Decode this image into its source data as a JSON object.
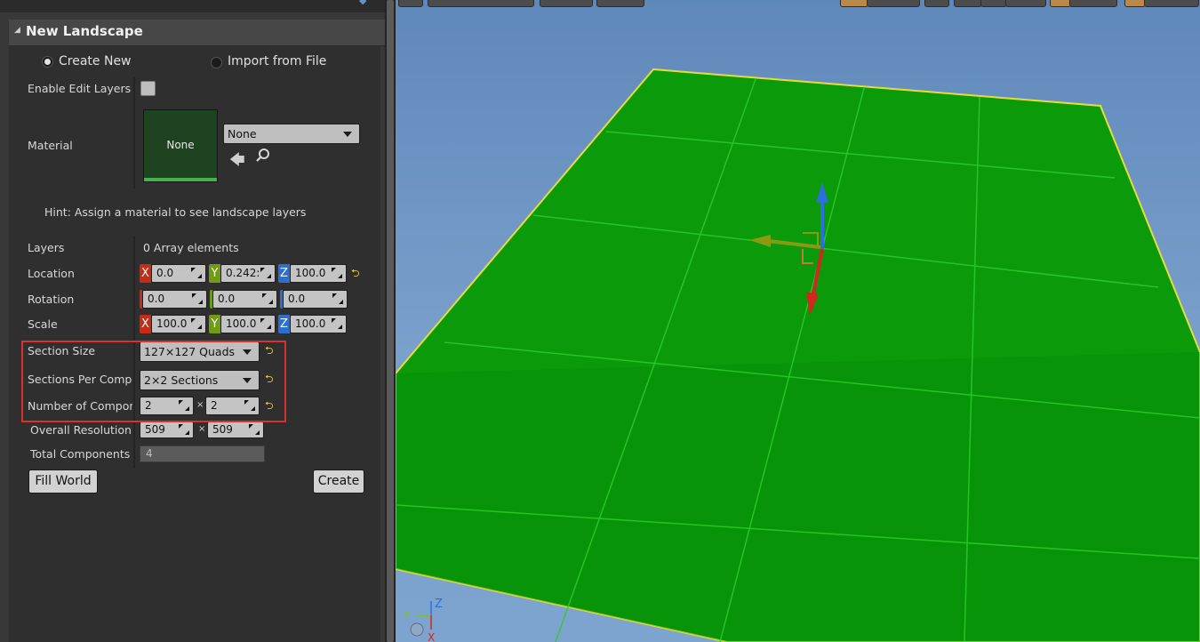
{
  "panel": {
    "section_title": "New Landscape",
    "mode": {
      "create_new_label": "Create New",
      "import_label": "Import from File",
      "selected": "create_new"
    },
    "enable_edit_layers": {
      "label": "Enable Edit Layers",
      "checked": false
    },
    "material": {
      "label": "Material",
      "thumbnail_text": "None",
      "combo_value": "None"
    },
    "hint": "Hint: Assign a material to see landscape layers",
    "layers": {
      "label": "Layers",
      "value": "0 Array elements"
    },
    "location": {
      "label": "Location",
      "x": "0.0",
      "y": "0.242:",
      "z": "100.0"
    },
    "rotation": {
      "label": "Rotation",
      "x": "0.0",
      "y": "0.0",
      "z": "0.0"
    },
    "scale": {
      "label": "Scale",
      "x": "100.0",
      "y": "100.0",
      "z": "100.0"
    },
    "section_size": {
      "label": "Section Size",
      "value": "127×127 Quads"
    },
    "sections_per_component": {
      "label": "Sections Per Compor",
      "value": "2×2 Sections"
    },
    "number_of_components": {
      "label": "Number of Compone",
      "x": "2",
      "y": "2"
    },
    "overall_resolution": {
      "label": "Overall Resolution",
      "x": "509",
      "y": "509"
    },
    "total_components": {
      "label": "Total Components",
      "value": "4"
    },
    "axis_letters": {
      "x": "X",
      "y": "Y",
      "z": "Z"
    },
    "times_symbol": "×",
    "fill_world_label": "Fill World",
    "create_label": "Create"
  },
  "viewport": {
    "gizmo_labels": {
      "x": "X",
      "y": "Y",
      "z": "Z"
    }
  },
  "colors": {
    "landscape_green": "#0a9a0a",
    "sky": "#6b93c4",
    "highlight": "#d8322f",
    "axis_x": "#c52b16",
    "axis_y": "#6f9c14",
    "axis_z": "#2b6fd1"
  }
}
